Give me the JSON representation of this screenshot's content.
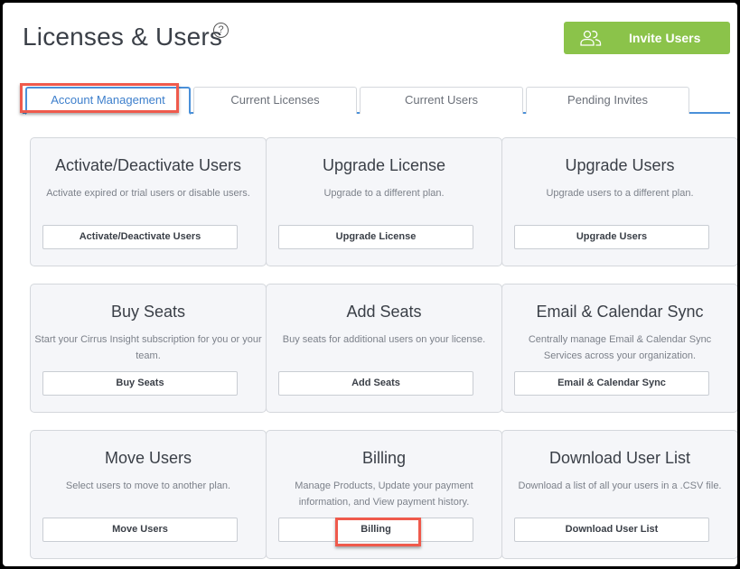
{
  "header": {
    "title": "Licenses & Users",
    "help_icon": "question-circle-icon",
    "help_glyph": "?",
    "invite_button": {
      "label": "Invite Users",
      "icon": "users-icon",
      "color": "#8bc34a"
    }
  },
  "tabs": [
    {
      "label": "Account Management",
      "active": true
    },
    {
      "label": "Current Licenses",
      "active": false
    },
    {
      "label": "Current Users",
      "active": false
    },
    {
      "label": "Pending Invites",
      "active": false
    }
  ],
  "cards": [
    {
      "title": "Activate/Deactivate Users",
      "description": "Activate expired or trial users or disable users.",
      "button": "Activate/Deactivate Users"
    },
    {
      "title": "Upgrade License",
      "description": "Upgrade to a different plan.",
      "button": "Upgrade License"
    },
    {
      "title": "Upgrade Users",
      "description": "Upgrade users to a different plan.",
      "button": "Upgrade Users"
    },
    {
      "title": "Buy Seats",
      "description": "Start your Cirrus Insight subscription for you or your team.",
      "button": "Buy Seats"
    },
    {
      "title": "Add Seats",
      "description": "Buy seats for additional users on your license.",
      "button": "Add Seats"
    },
    {
      "title": "Email & Calendar Sync",
      "description": "Centrally manage Email & Calendar Sync Services across your organization.",
      "button": "Email & Calendar Sync"
    },
    {
      "title": "Move Users",
      "description": "Select users to move to another plan.",
      "button": "Move Users"
    },
    {
      "title": "Billing",
      "description": "Manage Products, Update your payment information, and View payment history.",
      "button": "Billing"
    },
    {
      "title": "Download User List",
      "description": "Download a list of all your users in a .CSV file.",
      "button": "Download User List"
    }
  ],
  "annotations": {
    "highlight_color": "#ef5a4c",
    "highlighted": [
      "Account Management tab",
      "Billing button"
    ]
  }
}
